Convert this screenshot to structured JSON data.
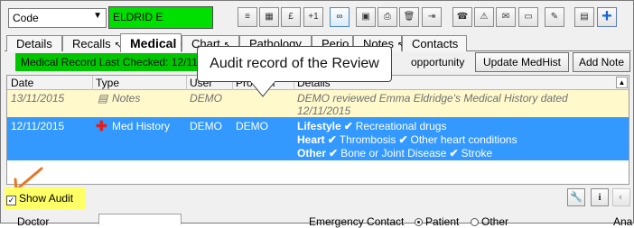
{
  "toolbar": {
    "code_select": "Code",
    "patient_name": "ELDRID E",
    "buttons": [
      {
        "icon": "list-icon",
        "glyph": "≡"
      },
      {
        "icon": "calculator-icon",
        "glyph": "▦"
      },
      {
        "icon": "pound-icon",
        "glyph": "£"
      },
      {
        "icon": "plus-one-icon",
        "glyph": "+1"
      },
      {
        "icon": "link-icon",
        "glyph": "∞"
      },
      {
        "icon": "save-icon",
        "glyph": "▣"
      },
      {
        "icon": "print-icon",
        "glyph": "⎙"
      },
      {
        "icon": "delete-icon",
        "glyph": "🗑"
      },
      {
        "icon": "merge-icon",
        "glyph": "⇥"
      },
      {
        "icon": "phone-icon",
        "glyph": "☎"
      },
      {
        "icon": "alert-icon",
        "glyph": "⚠"
      },
      {
        "icon": "message-icon",
        "glyph": "✉"
      },
      {
        "icon": "card-icon",
        "glyph": "▭"
      },
      {
        "icon": "note-icon",
        "glyph": "✎"
      },
      {
        "icon": "calendar-icon",
        "glyph": "▤"
      },
      {
        "icon": "add-icon",
        "glyph": "+"
      }
    ]
  },
  "tabs": [
    {
      "label": "Details",
      "indicator": ""
    },
    {
      "label": "Recalls",
      "indicator": "↖"
    },
    {
      "label": "Medical",
      "indicator": "↖"
    },
    {
      "label": "Chart",
      "indicator": "↖"
    },
    {
      "label": "Pathology",
      "indicator": ""
    },
    {
      "label": "Perio",
      "indicator": ""
    },
    {
      "label": "Notes",
      "indicator": "↖"
    },
    {
      "label": "Contacts",
      "indicator": ""
    }
  ],
  "status": {
    "text": "Medical Record Last Checked: 12/11/2015",
    "tail": "opportunity"
  },
  "buttons": {
    "update_medhist": "Update MedHist",
    "add_note": "Add Note"
  },
  "grid": {
    "headers": [
      "Date",
      "Type",
      "User",
      "Provider",
      "Details"
    ],
    "audit_row": {
      "date": "13/11/2015",
      "type": "Notes",
      "user": "DEMO",
      "details_1": "DEMO reviewed Emma Eldridge's Medical History dated",
      "details_2": "12/11/2015"
    },
    "selected_row": {
      "date": "12/11/2015",
      "type": "Med History",
      "user": "DEMO",
      "provider": "DEMO",
      "lines": [
        {
          "label": "Lifestyle",
          "items": [
            "Recreational drugs"
          ]
        },
        {
          "label": "Heart",
          "items": [
            "Thrombosis",
            "Other heart conditions"
          ]
        },
        {
          "label": "Other",
          "items": [
            "Bone or Joint Disease",
            "Stroke"
          ]
        }
      ]
    }
  },
  "callout": {
    "text": "Audit record of the Review"
  },
  "show_audit": {
    "label": "Show Audit",
    "checked": true
  },
  "footer": {
    "doctor_label": "Doctor",
    "emergency_label": "Emergency Contact",
    "radio_patient": "Patient",
    "radio_other": "Other",
    "trailing": "Ana"
  },
  "colors": {
    "status_green": "#00c600",
    "name_green": "#00e000",
    "selection_blue": "#3399ff",
    "audit_yellow": "#fff9cc",
    "highlight_yellow": "#ffff66",
    "arrow_orange": "#e87722",
    "cross_red": "#e02020"
  }
}
